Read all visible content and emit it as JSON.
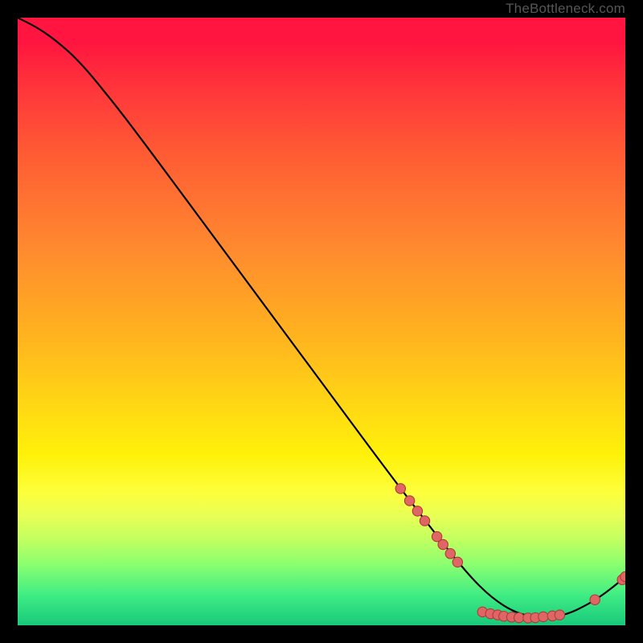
{
  "attribution": "TheBottleneck.com",
  "chart_data": {
    "type": "line",
    "title": "",
    "xlabel": "",
    "ylabel": "",
    "xlim": [
      0,
      100
    ],
    "ylim": [
      0,
      100
    ],
    "grid": false,
    "legend": false,
    "curve": [
      {
        "x": 0,
        "y": 100
      },
      {
        "x": 3,
        "y": 98.5
      },
      {
        "x": 6,
        "y": 96.5
      },
      {
        "x": 10,
        "y": 93
      },
      {
        "x": 15,
        "y": 87
      },
      {
        "x": 20,
        "y": 80.5
      },
      {
        "x": 30,
        "y": 67
      },
      {
        "x": 40,
        "y": 53.5
      },
      {
        "x": 50,
        "y": 40
      },
      {
        "x": 60,
        "y": 26.5
      },
      {
        "x": 68,
        "y": 16
      },
      {
        "x": 74,
        "y": 8.5
      },
      {
        "x": 78,
        "y": 4.5
      },
      {
        "x": 82,
        "y": 2
      },
      {
        "x": 86,
        "y": 1.2
      },
      {
        "x": 90,
        "y": 1.6
      },
      {
        "x": 94,
        "y": 3.5
      },
      {
        "x": 97,
        "y": 5.5
      },
      {
        "x": 100,
        "y": 8
      }
    ],
    "markers": [
      {
        "x": 63.0,
        "y": 22.5
      },
      {
        "x": 64.5,
        "y": 20.5
      },
      {
        "x": 65.8,
        "y": 18.8
      },
      {
        "x": 67.0,
        "y": 17.2
      },
      {
        "x": 69.0,
        "y": 14.6
      },
      {
        "x": 70.0,
        "y": 13.3
      },
      {
        "x": 71.2,
        "y": 11.8
      },
      {
        "x": 72.4,
        "y": 10.4
      },
      {
        "x": 76.5,
        "y": 2.2
      },
      {
        "x": 77.8,
        "y": 1.9
      },
      {
        "x": 79.0,
        "y": 1.7
      },
      {
        "x": 80.0,
        "y": 1.5
      },
      {
        "x": 81.3,
        "y": 1.35
      },
      {
        "x": 82.5,
        "y": 1.25
      },
      {
        "x": 84.0,
        "y": 1.2
      },
      {
        "x": 85.2,
        "y": 1.25
      },
      {
        "x": 86.5,
        "y": 1.4
      },
      {
        "x": 88.0,
        "y": 1.55
      },
      {
        "x": 89.2,
        "y": 1.7
      },
      {
        "x": 95.0,
        "y": 4.2
      },
      {
        "x": 99.5,
        "y": 7.5
      },
      {
        "x": 100.0,
        "y": 8.0
      }
    ],
    "marker_radius_px": 6.2,
    "colors": {
      "curve": "#000000",
      "marker_fill": "#e06666",
      "marker_stroke": "#b03a3a",
      "gradient_top": "#ff153f",
      "gradient_bottom": "#18c97b"
    }
  }
}
